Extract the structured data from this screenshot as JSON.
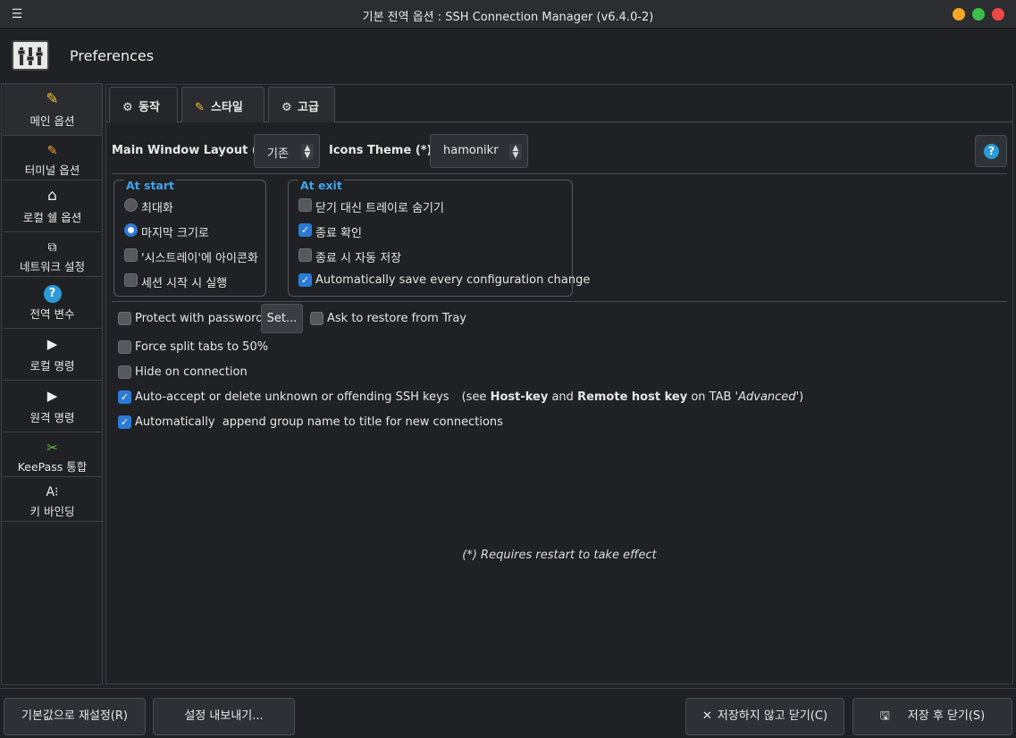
{
  "window": {
    "title": "기본 전역 옵션 : SSH Connection Manager (v6.4.0-2)",
    "menu_icon": "hamburger-icon",
    "controls": [
      "minimize",
      "maximize",
      "close"
    ]
  },
  "header": {
    "title": "Preferences",
    "icon": "preferences-sliders-icon"
  },
  "sidebar": {
    "items": [
      {
        "label": "메인 옵션",
        "icon": "rainbow-tools-icon"
      },
      {
        "label": "터미널 옵션",
        "icon": "terminal-tools-icon"
      },
      {
        "label": "로컬 쉘 옵션",
        "icon": "home-icon"
      },
      {
        "label": "네트워크 설정",
        "icon": "network-icon"
      },
      {
        "label": "전역 변수",
        "icon": "help-circle-icon"
      },
      {
        "label": "로컬 명령",
        "icon": "play-icon"
      },
      {
        "label": "원격 명령",
        "icon": "play-icon"
      },
      {
        "label": "KeePass 통합",
        "icon": "keepass-icon"
      },
      {
        "label": "키 바인딩",
        "icon": "keybinding-icon"
      }
    ]
  },
  "tabs": [
    {
      "label": "동작",
      "icon": "gear-badge-icon",
      "active": true
    },
    {
      "label": "스타일",
      "icon": "style-icon",
      "active": false
    },
    {
      "label": "고급",
      "icon": "gear-icon",
      "active": false
    }
  ],
  "layout_row": {
    "main_window_layout_label": "Main Window Layout (*)",
    "main_window_layout_value": "기존",
    "icons_theme_label": "Icons Theme (*)",
    "icons_theme_value": "hamonikr"
  },
  "at_start": {
    "title": "At start",
    "options": [
      {
        "label": "최대화",
        "selected": false
      },
      {
        "label": "마지막 크기로",
        "selected": true
      }
    ],
    "checks": [
      {
        "label": "'시스트레이'에 아이콘화",
        "checked": false
      },
      {
        "label": "세션 시작 시 실행",
        "checked": false
      }
    ]
  },
  "at_exit": {
    "title": "At exit",
    "checks": [
      {
        "label": "닫기 대신 트레이로 숨기기",
        "checked": false
      },
      {
        "label": "종료 확인",
        "checked": true
      },
      {
        "label": "종료 시 자동 저장",
        "checked": false
      },
      {
        "label": "Automatically save every configuration change",
        "checked": true
      }
    ]
  },
  "options": {
    "protect_password": {
      "label": "Protect with password",
      "checked": false
    },
    "set_button": "Set...",
    "ask_restore": {
      "label": "Ask to restore from Tray",
      "checked": false
    },
    "force_split": {
      "label": "Force split tabs to 50%",
      "checked": false
    },
    "hide_on_connection": {
      "label": "Hide on connection",
      "checked": false
    },
    "auto_accept": {
      "checked": true,
      "label": "Auto-accept or delete unknown or offending SSH keys",
      "note_prefix": "(see ",
      "host_key": "Host-key",
      "and": " and ",
      "remote_host_key": "Remote host key",
      "on_tab": " on TAB '",
      "advanced": "Advanced",
      "note_suffix": "')"
    },
    "append_group": {
      "label": "Automatically  append group name to title for new connections",
      "checked": true
    }
  },
  "restart_note": "(*) Requires restart to take effect",
  "footer": {
    "reset_label": "기본값으로 재설정(R)",
    "export_label": "설정 내보내기...",
    "close_nosave_label": "저장하지 않고 닫기(C)",
    "save_close_label": "저장 후 닫기(S)"
  }
}
